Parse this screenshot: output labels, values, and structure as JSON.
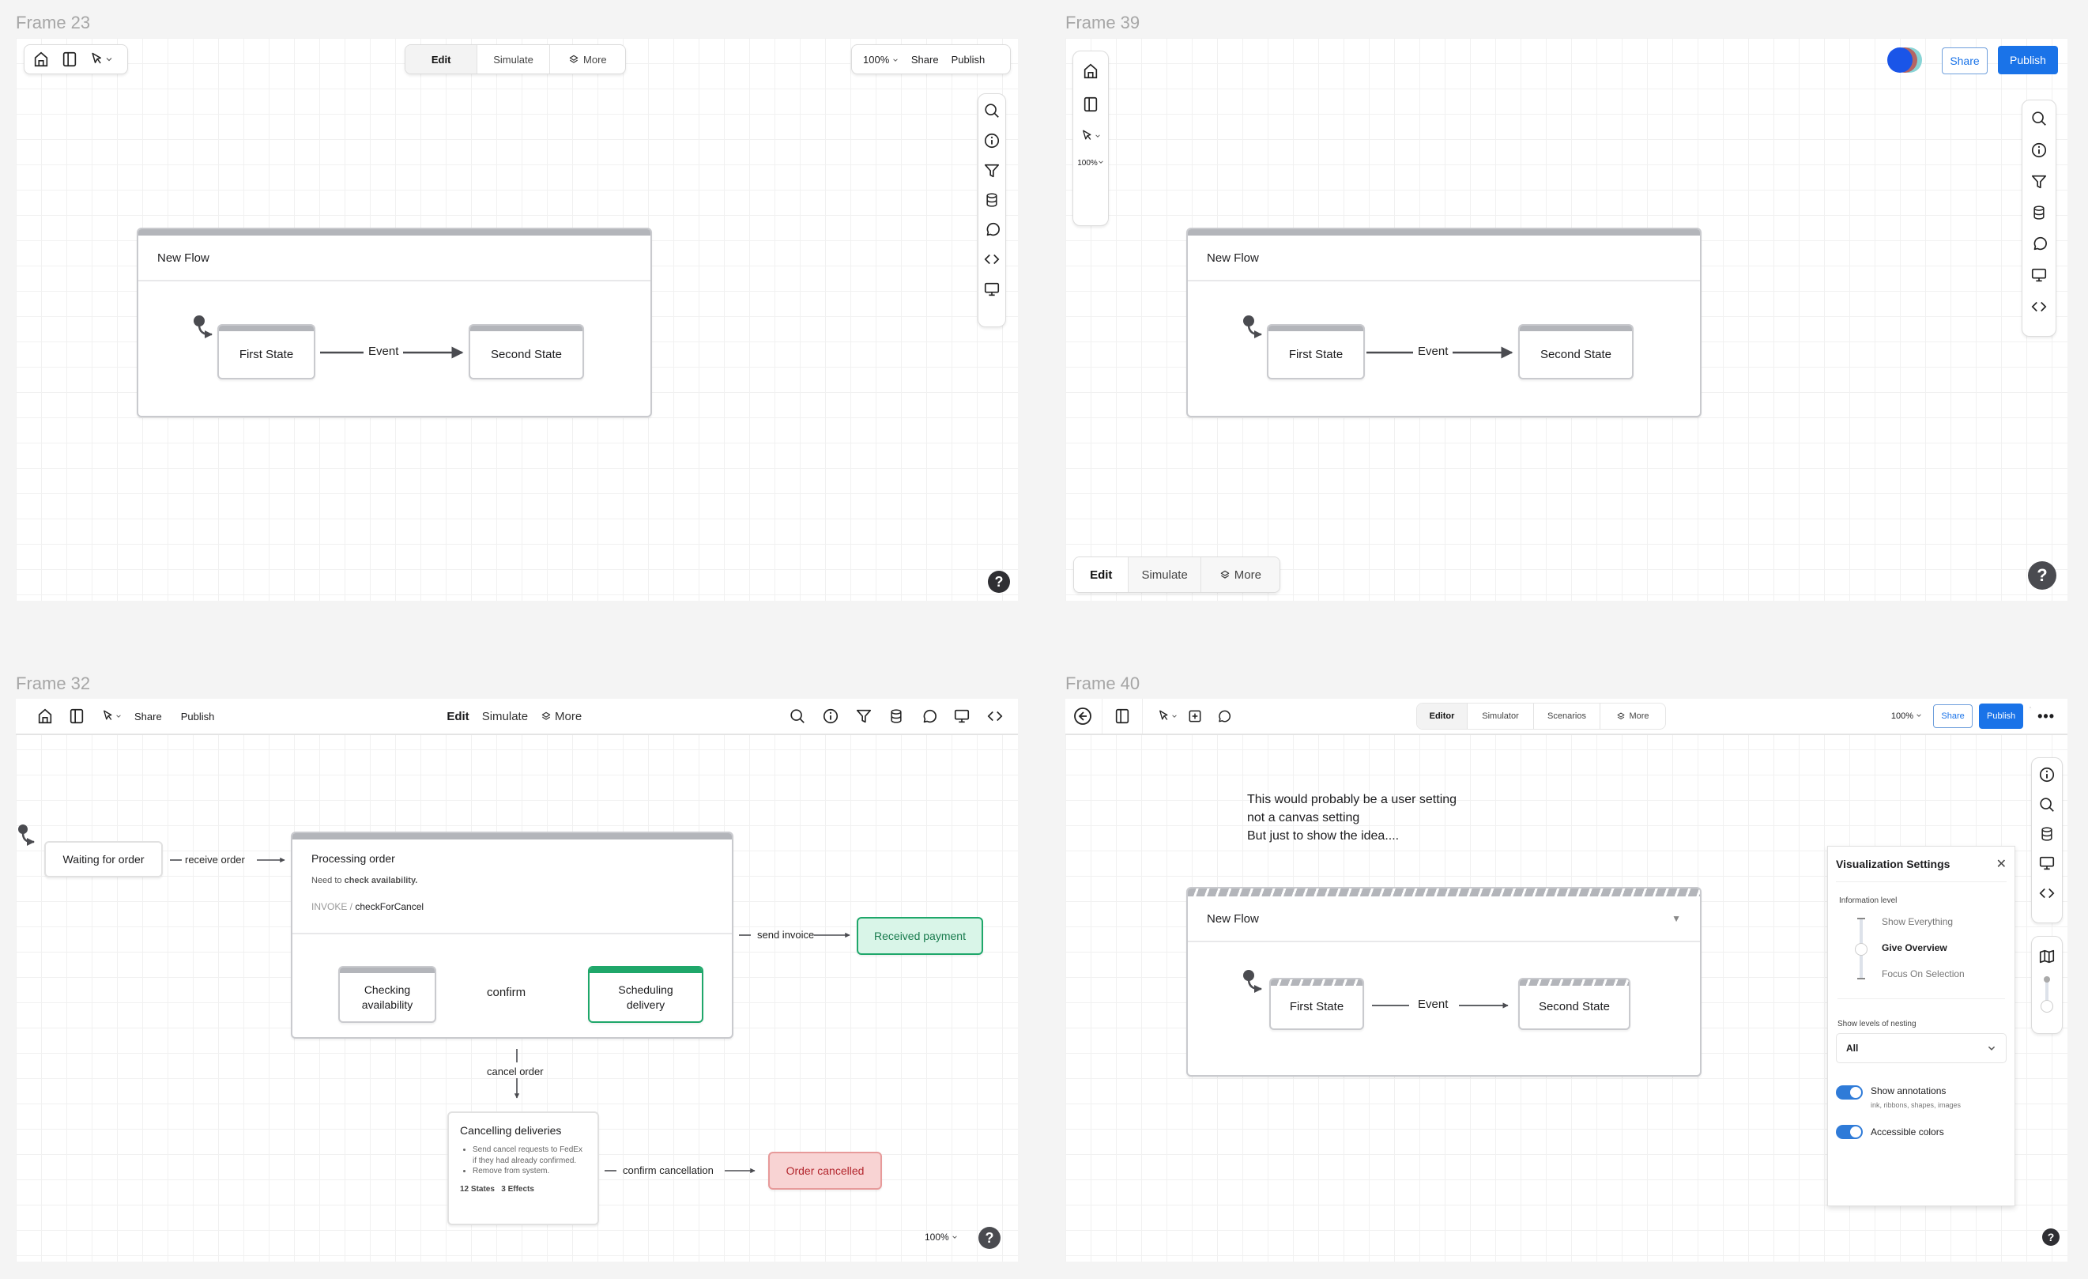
{
  "frames": {
    "f23": {
      "label": "Frame 23",
      "left_toolbar": {
        "icons": [
          "home-icon",
          "sidebar-icon",
          "pointer-icon"
        ]
      },
      "mode_tabs": [
        {
          "label": "Edit",
          "active": true
        },
        {
          "label": "Simulate"
        },
        {
          "label": "More",
          "icon": "layers-icon"
        }
      ],
      "right_toolbar": {
        "zoom": "100%",
        "share": "Share",
        "publish": "Publish"
      },
      "side_tools": [
        "search-icon",
        "info-icon",
        "filter-icon",
        "database-icon",
        "comment-icon",
        "code-icon",
        "monitor-icon"
      ],
      "flow": {
        "title": "New Flow",
        "states": [
          "First State",
          "Second State"
        ],
        "event": "Event"
      },
      "help": "?"
    },
    "f39": {
      "label": "Frame 39",
      "left_toolbar": {
        "zoom": "100%"
      },
      "share": "Share",
      "publish": "Publish",
      "side_tools": [
        "search-icon",
        "info-icon",
        "filter-icon",
        "database-icon",
        "comment-icon",
        "monitor-icon",
        "code-icon"
      ],
      "mode_tabs": [
        {
          "label": "Edit",
          "active": true
        },
        {
          "label": "Simulate"
        },
        {
          "label": "More",
          "icon": "layers-icon"
        }
      ],
      "flow": {
        "title": "New Flow",
        "states": [
          "First State",
          "Second State"
        ],
        "event": "Event"
      },
      "help": "?"
    },
    "f32": {
      "label": "Frame 32",
      "toolbar": {
        "share": "Share",
        "publish": "Publish",
        "tabs": [
          "Edit",
          "Simulate",
          "More"
        ]
      },
      "diagram": {
        "waiting": "Waiting for order",
        "receive": "receive order",
        "processing": {
          "title": "Processing order",
          "desc_prefix": "Need to ",
          "desc_bold": "check availability.",
          "invoke_label": "INVOKE /",
          "invoke_value": "checkForCancel"
        },
        "checking": "Checking availability",
        "confirm": "confirm",
        "scheduling": "Scheduling delivery",
        "send_invoice": "send invoice",
        "received_payment": "Received payment",
        "cancel_order": "cancel order",
        "cancelling": {
          "title": "Cancelling deliveries",
          "bullets": [
            "Send cancel requests to FedEx if they had already confirmed.",
            "Remove from system."
          ],
          "stats": "12 States   3 Effects"
        },
        "confirm_cancellation": "confirm cancellation",
        "order_cancelled": "Order cancelled"
      },
      "zoom": "100%",
      "help": "?",
      "colors": {
        "success": "#1fa76a",
        "success_bg": "#d9f5e8",
        "danger": "#b3262d",
        "danger_bg": "#f8d3d3"
      }
    },
    "f40": {
      "label": "Frame 40",
      "toolbar": {
        "tabs": [
          {
            "label": "Editor",
            "active": true
          },
          {
            "label": "Simulator"
          },
          {
            "label": "Scenarios"
          },
          {
            "label": "More"
          }
        ],
        "zoom": "100%",
        "share": "Share",
        "publish": "Publish"
      },
      "note": [
        "This would probably be a user setting",
        "not a canvas setting",
        "But just to show the idea...."
      ],
      "flow": {
        "title": "New Flow",
        "states": [
          "First State",
          "Second State"
        ],
        "event": "Event"
      },
      "settings": {
        "title": "Visualization Settings",
        "info_level_label": "Information level",
        "levels": [
          "Show Everything",
          "Give Overview",
          "Focus On Selection"
        ],
        "selected_level": "Give Overview",
        "nesting_label": "Show levels of nesting",
        "nesting_value": "All",
        "annotations_label": "Show annotations",
        "annotations_hint": "ink, ribbons, shapes, images",
        "annotations_on": true,
        "accessible_label": "Accessible colors",
        "accessible_on": true
      },
      "help": "?"
    }
  },
  "colors": {
    "primary": "#1a73e8"
  }
}
